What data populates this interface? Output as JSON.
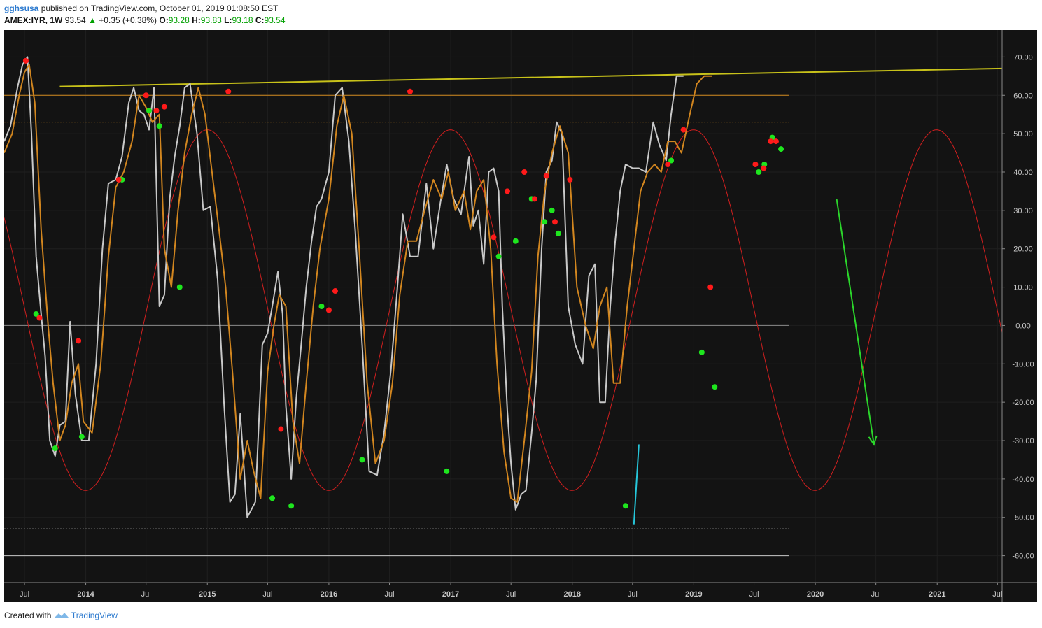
{
  "header": {
    "author": "gghsusa",
    "published_text": "published on TradingView.com, October 01, 2019 01:08:50 EST",
    "symbol": "AMEX:IYR, 1W",
    "last": "93.54",
    "change": "+0.35 (+0.38%)",
    "o_label": "O:",
    "o_value": "93.28",
    "h_label": "H:",
    "h_value": "93.83",
    "l_label": "L:",
    "l_value": "93.18",
    "c_label": "C:",
    "c_value": "93.54"
  },
  "footer": {
    "created_with": "Created with",
    "brand": "TradingView"
  },
  "colors": {
    "background": "#131313",
    "oscillator": "#c9c9c9",
    "signal": "#d2861f",
    "sine_cycle": "#d11f1f",
    "trendline": "#c8c21a",
    "level_60": "#d28a1f",
    "level_53": "#d28a1f",
    "level_0": "#8a8a8a",
    "level_neg53": "#c9c9c9",
    "level_neg60": "#c9c9c9",
    "cross_up": "#1ee61e",
    "cross_down": "#ff1a1a",
    "forecast_arrow": "#2bd62b",
    "cyan_line": "#26c6da"
  },
  "chart_data": {
    "type": "line",
    "symbol": "AMEX:IYR",
    "interval": "1W",
    "x_tick_labels": [
      "Jul",
      "2014",
      "Jul",
      "2015",
      "Jul",
      "2016",
      "Jul",
      "2017",
      "Jul",
      "2018",
      "Jul",
      "2019",
      "Jul",
      "2020",
      "Jul",
      "2021",
      "Jul"
    ],
    "x_range": [
      "2013-05-01",
      "2021-07-15"
    ],
    "ylim": [
      -67,
      77
    ],
    "y_tick_labels": [
      "70.00",
      "60.00",
      "50.00",
      "40.00",
      "30.00",
      "20.00",
      "10.00",
      "0.00",
      "-10.00",
      "-20.00",
      "-30.00",
      "-40.00",
      "-50.00",
      "-60.00"
    ],
    "y_ticks": [
      70,
      60,
      50,
      40,
      30,
      20,
      10,
      0,
      -10,
      -20,
      -30,
      -40,
      -50,
      -60
    ],
    "grid": true,
    "horizontal_levels": [
      {
        "value": 60,
        "style": "solid",
        "color_key": "level_60"
      },
      {
        "value": 53,
        "style": "dotted",
        "color_key": "level_53"
      },
      {
        "value": 0,
        "style": "solid",
        "color_key": "level_0"
      },
      {
        "value": -53,
        "style": "dotted",
        "color_key": "level_neg53"
      },
      {
        "value": -60,
        "style": "solid",
        "color_key": "level_neg60"
      }
    ],
    "trendline": {
      "from": [
        "2013-10-15",
        62.3
      ],
      "to": [
        "2021-07-15",
        67
      ]
    },
    "sine_cycle": {
      "amplitude": 47,
      "center": 4,
      "period_days": 730,
      "peak_date": "2015-01-01"
    },
    "oscillator": {
      "x": [
        "2013-05-01",
        "2013-05-20",
        "2013-06-10",
        "2013-06-25",
        "2013-07-10",
        "2013-07-22",
        "2013-08-05",
        "2013-08-20",
        "2013-09-01",
        "2013-09-15",
        "2013-10-01",
        "2013-10-15",
        "2013-11-01",
        "2013-11-15",
        "2013-12-01",
        "2013-12-20",
        "2014-01-10",
        "2014-02-01",
        "2014-02-20",
        "2014-03-10",
        "2014-04-01",
        "2014-04-20",
        "2014-05-10",
        "2014-05-25",
        "2014-06-10",
        "2014-06-25",
        "2014-07-10",
        "2014-07-25",
        "2014-08-10",
        "2014-08-25",
        "2014-09-10",
        "2014-09-25",
        "2014-10-10",
        "2014-10-25",
        "2014-11-10",
        "2014-12-01",
        "2014-12-20",
        "2015-01-10",
        "2015-02-01",
        "2015-02-20",
        "2015-03-10",
        "2015-03-25",
        "2015-04-10",
        "2015-05-01",
        "2015-05-25",
        "2015-06-15",
        "2015-07-01",
        "2015-07-15",
        "2015-08-01",
        "2015-08-15",
        "2015-08-25",
        "2015-09-10",
        "2015-09-25",
        "2015-10-10",
        "2015-10-25",
        "2015-11-10",
        "2015-11-25",
        "2015-12-10",
        "2016-01-01",
        "2016-01-20",
        "2016-02-10",
        "2016-03-01",
        "2016-03-20",
        "2016-04-10",
        "2016-05-01",
        "2016-05-25",
        "2016-06-15",
        "2016-07-05",
        "2016-07-25",
        "2016-08-10",
        "2016-09-01",
        "2016-09-25",
        "2016-10-20",
        "2016-11-10",
        "2016-12-01",
        "2016-12-20",
        "2017-01-10",
        "2017-02-01",
        "2017-02-25",
        "2017-03-10",
        "2017-03-25",
        "2017-04-10",
        "2017-04-25",
        "2017-05-10",
        "2017-05-25",
        "2017-06-05",
        "2017-06-20",
        "2017-07-01",
        "2017-07-15",
        "2017-08-01",
        "2017-08-15",
        "2017-09-01",
        "2017-09-15",
        "2017-10-01",
        "2017-10-15",
        "2017-11-01",
        "2017-11-15",
        "2017-12-01",
        "2017-12-20",
        "2018-01-10",
        "2018-02-01",
        "2018-02-20",
        "2018-03-10",
        "2018-03-25",
        "2018-04-10",
        "2018-04-25",
        "2018-05-10",
        "2018-05-25",
        "2018-06-10",
        "2018-07-01",
        "2018-07-20",
        "2018-08-10",
        "2018-09-01",
        "2018-09-20",
        "2018-10-10",
        "2018-10-25",
        "2018-11-10",
        "2018-12-01",
        "2018-12-20",
        "2019-01-10",
        "2019-02-01",
        "2019-02-25",
        "2019-03-20",
        "2019-04-10",
        "2019-04-25",
        "2019-05-10",
        "2019-05-25",
        "2019-06-10",
        "2019-06-25",
        "2019-07-10",
        "2019-07-25",
        "2019-08-10",
        "2019-08-25",
        "2019-09-10",
        "2019-09-25"
      ],
      "y": [
        48,
        52,
        62,
        68,
        70,
        50,
        18,
        3,
        -8,
        -30,
        -34,
        -26,
        -25,
        1,
        -18,
        -30,
        -30,
        -10,
        20,
        37,
        38,
        44,
        58,
        62,
        56,
        55,
        51,
        62,
        5,
        8,
        33,
        44,
        52,
        62,
        63,
        50,
        30,
        31,
        12,
        -20,
        -46,
        -44,
        -23,
        -50,
        -46,
        -5,
        -2,
        5,
        14,
        3,
        -21,
        -40,
        -19,
        -5,
        10,
        22,
        31,
        33,
        40,
        60,
        62,
        48,
        25,
        -5,
        -38,
        -39,
        -28,
        -12,
        10,
        29,
        18,
        18,
        37,
        20,
        32,
        42,
        33,
        29,
        44,
        26,
        30,
        16,
        40,
        41,
        35,
        5,
        -22,
        -36,
        -48,
        -44,
        -43,
        -28,
        -14,
        20,
        40,
        43,
        53,
        50,
        5,
        -5,
        -10,
        13,
        16,
        -20,
        -20,
        5,
        22,
        35,
        42,
        41,
        41,
        40,
        53,
        47,
        43,
        55,
        65,
        65
      ]
    },
    "signal_line": {
      "x": [
        "2013-05-01",
        "2013-05-25",
        "2013-06-15",
        "2013-07-01",
        "2013-07-15",
        "2013-08-01",
        "2013-08-20",
        "2013-09-10",
        "2013-09-25",
        "2013-10-15",
        "2013-11-01",
        "2013-11-20",
        "2013-12-10",
        "2013-12-25",
        "2014-01-20",
        "2014-02-15",
        "2014-03-10",
        "2014-04-01",
        "2014-04-25",
        "2014-05-20",
        "2014-06-10",
        "2014-06-30",
        "2014-07-20",
        "2014-08-10",
        "2014-08-25",
        "2014-09-15",
        "2014-10-05",
        "2014-10-25",
        "2014-11-15",
        "2014-12-05",
        "2014-12-25",
        "2015-01-15",
        "2015-02-05",
        "2015-02-25",
        "2015-03-20",
        "2015-04-10",
        "2015-05-01",
        "2015-05-20",
        "2015-06-10",
        "2015-07-01",
        "2015-07-20",
        "2015-08-05",
        "2015-08-25",
        "2015-09-15",
        "2015-10-05",
        "2015-10-25",
        "2015-11-15",
        "2015-12-05",
        "2016-01-01",
        "2016-01-25",
        "2016-02-15",
        "2016-03-10",
        "2016-04-01",
        "2016-04-25",
        "2016-05-20",
        "2016-06-15",
        "2016-07-10",
        "2016-08-01",
        "2016-08-25",
        "2016-09-20",
        "2016-10-15",
        "2016-11-10",
        "2016-12-05",
        "2016-12-25",
        "2017-01-15",
        "2017-02-10",
        "2017-03-01",
        "2017-03-20",
        "2017-04-10",
        "2017-05-01",
        "2017-05-20",
        "2017-06-10",
        "2017-07-01",
        "2017-07-20",
        "2017-08-10",
        "2017-09-01",
        "2017-09-20",
        "2017-10-10",
        "2017-11-01",
        "2017-11-25",
        "2017-12-20",
        "2018-01-15",
        "2018-02-10",
        "2018-03-05",
        "2018-03-25",
        "2018-04-15",
        "2018-05-05",
        "2018-05-25",
        "2018-06-15",
        "2018-07-05",
        "2018-07-25",
        "2018-08-15",
        "2018-09-05",
        "2018-09-25",
        "2018-10-15",
        "2018-11-05",
        "2018-11-25",
        "2018-12-20",
        "2019-01-10",
        "2019-02-01",
        "2019-02-25",
        "2019-03-20",
        "2019-04-10",
        "2019-05-01",
        "2019-05-20",
        "2019-06-10",
        "2019-06-30",
        "2019-07-20",
        "2019-08-10",
        "2019-08-30",
        "2019-09-20"
      ],
      "y": [
        45,
        50,
        60,
        66,
        68,
        58,
        25,
        0,
        -15,
        -30,
        -26,
        -15,
        -10,
        -25,
        -28,
        -10,
        18,
        36,
        40,
        48,
        60,
        57,
        53,
        55,
        20,
        10,
        30,
        45,
        55,
        62,
        55,
        40,
        25,
        10,
        -15,
        -40,
        -30,
        -38,
        -45,
        -12,
        0,
        8,
        5,
        -25,
        -36,
        -15,
        5,
        20,
        33,
        52,
        60,
        50,
        20,
        -15,
        -36,
        -30,
        -15,
        8,
        22,
        22,
        30,
        38,
        33,
        40,
        30,
        35,
        25,
        35,
        38,
        20,
        -10,
        -33,
        -45,
        -46,
        -30,
        -12,
        18,
        35,
        45,
        52,
        45,
        10,
        0,
        -6,
        5,
        10,
        -15,
        -15,
        5,
        20,
        35,
        40,
        42,
        40,
        48,
        48,
        45,
        55,
        63,
        65,
        65
      ]
    },
    "crossovers_green": [
      {
        "x": "2013-08-05",
        "y": 3
      },
      {
        "x": "2013-10-01",
        "y": -32
      },
      {
        "x": "2013-12-20",
        "y": -29
      },
      {
        "x": "2014-04-20",
        "y": 38
      },
      {
        "x": "2014-07-10",
        "y": 56
      },
      {
        "x": "2014-08-10",
        "y": 52
      },
      {
        "x": "2014-10-10",
        "y": 10
      },
      {
        "x": "2015-07-15",
        "y": -45
      },
      {
        "x": "2015-09-10",
        "y": -47
      },
      {
        "x": "2015-12-10",
        "y": 5
      },
      {
        "x": "2016-04-10",
        "y": -35
      },
      {
        "x": "2016-12-20",
        "y": -38
      },
      {
        "x": "2017-05-25",
        "y": 18
      },
      {
        "x": "2017-07-15",
        "y": 22
      },
      {
        "x": "2017-09-01",
        "y": 33
      },
      {
        "x": "2017-10-10",
        "y": 27
      },
      {
        "x": "2017-11-01",
        "y": 30
      },
      {
        "x": "2017-11-20",
        "y": 24
      },
      {
        "x": "2018-06-10",
        "y": -47
      },
      {
        "x": "2018-10-25",
        "y": 43
      },
      {
        "x": "2019-01-25",
        "y": -7
      },
      {
        "x": "2019-03-05",
        "y": -16
      },
      {
        "x": "2019-07-15",
        "y": 40
      },
      {
        "x": "2019-08-01",
        "y": 42
      },
      {
        "x": "2019-08-25",
        "y": 49
      },
      {
        "x": "2019-09-20",
        "y": 46
      }
    ],
    "crossovers_red": [
      {
        "x": "2013-07-05",
        "y": 69
      },
      {
        "x": "2013-08-15",
        "y": 2
      },
      {
        "x": "2013-12-10",
        "y": -4
      },
      {
        "x": "2014-04-10",
        "y": 38
      },
      {
        "x": "2014-07-01",
        "y": 60
      },
      {
        "x": "2014-08-01",
        "y": 56
      },
      {
        "x": "2014-08-25",
        "y": 57
      },
      {
        "x": "2015-03-05",
        "y": 61
      },
      {
        "x": "2015-08-10",
        "y": -27
      },
      {
        "x": "2016-01-01",
        "y": 4
      },
      {
        "x": "2016-01-20",
        "y": 9
      },
      {
        "x": "2016-09-01",
        "y": 61
      },
      {
        "x": "2017-05-10",
        "y": 23
      },
      {
        "x": "2017-06-20",
        "y": 35
      },
      {
        "x": "2017-08-10",
        "y": 40
      },
      {
        "x": "2017-09-10",
        "y": 33
      },
      {
        "x": "2017-10-15",
        "y": 39
      },
      {
        "x": "2017-11-10",
        "y": 27
      },
      {
        "x": "2017-12-25",
        "y": 38
      },
      {
        "x": "2018-10-15",
        "y": 42
      },
      {
        "x": "2018-12-01",
        "y": 51
      },
      {
        "x": "2019-02-20",
        "y": 10
      },
      {
        "x": "2019-07-05",
        "y": 42
      },
      {
        "x": "2019-07-30",
        "y": 41
      },
      {
        "x": "2019-08-20",
        "y": 48
      },
      {
        "x": "2019-09-05",
        "y": 48
      }
    ],
    "forecast_arrow": {
      "from": [
        "2020-03-05",
        33
      ],
      "to": [
        "2020-06-25",
        -31
      ]
    },
    "cyan_segment": {
      "from": [
        "2018-07-05",
        -52
      ],
      "to": [
        "2018-07-20",
        -31
      ]
    }
  }
}
